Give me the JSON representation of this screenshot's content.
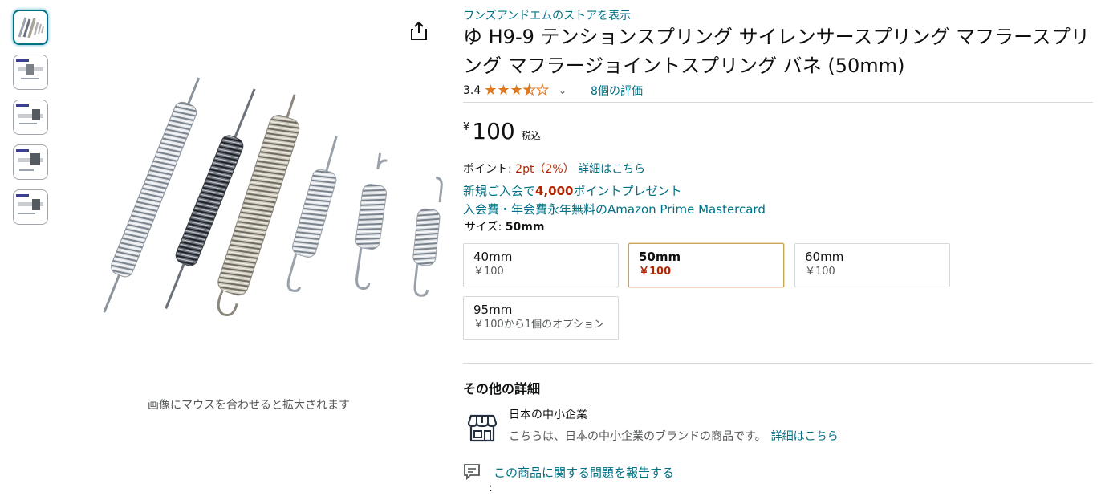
{
  "store_link": "ワンズアンドエムのストアを表示",
  "title": "ゆ H9-9 テンションスプリング サイレンサースプリング マフラースプリング マフラージョイントスプリング バネ (50mm)",
  "rating": {
    "value": "3.4",
    "stars_filled": 3.5,
    "reviews": "8個の評価"
  },
  "price": {
    "currency": "¥",
    "whole": "100",
    "tax_label": "税込"
  },
  "points": {
    "label": "ポイント:",
    "value": "2pt（2%）",
    "details_link": "詳細はこちら"
  },
  "promo": {
    "line1_pre": "新規ご入会で",
    "line1_bold": "4,000",
    "line1_post": "ポイントプレゼント",
    "line2": "入会費・年会費永年無料のAmazon Prime Mastercard"
  },
  "size": {
    "label": "サイズ:",
    "selected": "50mm"
  },
  "sizes": [
    {
      "name": "40mm",
      "price": "￥100"
    },
    {
      "name": "50mm",
      "price": "￥100"
    },
    {
      "name": "60mm",
      "price": "￥100"
    },
    {
      "name": "95mm",
      "price": "￥100から1個のオプション"
    }
  ],
  "hover_hint": "画像にマウスを合わせると拡大されます",
  "details": {
    "title": "その他の詳細",
    "sme_title": "日本の中小企業",
    "sme_desc": "こちらは、日本の中小企業のブランドの商品です。",
    "sme_link": "詳細はこちら"
  },
  "report_link": "この商品に関する問題を報告する",
  "colon": ":",
  "icons": {
    "share": "share-icon",
    "store": "store-icon",
    "report": "report-icon"
  },
  "colors": {
    "link": "#007185",
    "price_red": "#b12704",
    "star": "#de7921"
  }
}
